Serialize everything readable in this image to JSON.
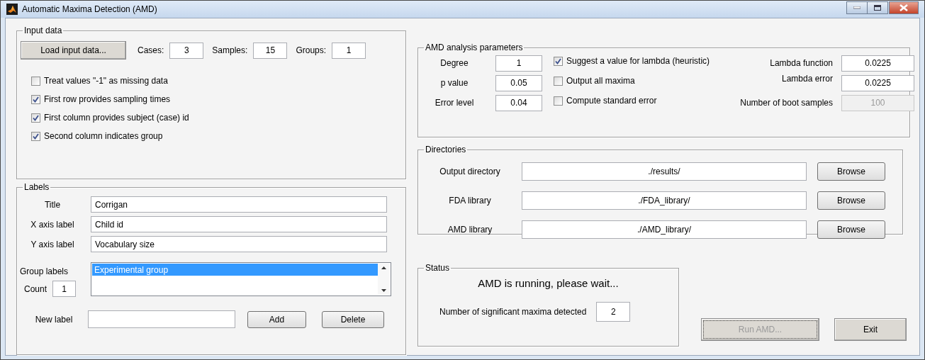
{
  "window": {
    "title": "Automatic Maxima Detection (AMD)"
  },
  "input_data": {
    "title": "Input data",
    "load_button": "Load input data...",
    "counts": [
      {
        "label": "Cases:",
        "value": "3"
      },
      {
        "label": "Samples:",
        "value": "15"
      },
      {
        "label": "Groups:",
        "value": "1"
      }
    ],
    "options": [
      {
        "label": "Treat values \"-1\" as missing data",
        "checked": false
      },
      {
        "label": "First row provides sampling times",
        "checked": true
      },
      {
        "label": "First column provides subject (case) id",
        "checked": true
      },
      {
        "label": "Second column indicates group",
        "checked": true
      }
    ]
  },
  "labels": {
    "title": "Labels",
    "fields": [
      {
        "label": "Title",
        "value": "Corrigan"
      },
      {
        "label": "X axis label",
        "value": "Child id"
      },
      {
        "label": "Y axis label",
        "value": "Vocabulary size"
      }
    ],
    "group_labels": {
      "label": "Group labels",
      "items": [
        {
          "text": "Experimental group",
          "selected": true
        }
      ]
    },
    "count": {
      "label": "Count",
      "value": "1"
    },
    "new_label": {
      "label": "New label"
    },
    "buttons": [
      "Add",
      "Delete"
    ]
  },
  "parameters": {
    "title": "AMD analysis parameters",
    "fields": [
      {
        "label": "Degree",
        "value": "1"
      },
      {
        "label": "p value",
        "value": "0.05"
      },
      {
        "label": "Error level",
        "value": "0.04"
      }
    ],
    "options": [
      {
        "label": "Suggest a value for lambda (heuristic)",
        "checked": true
      },
      {
        "label": "Output all maxima",
        "checked": false
      },
      {
        "label": "Compute standard error",
        "checked": false
      }
    ],
    "lambda_fields": [
      {
        "label": "Lambda function",
        "value": "0.0225",
        "disabled": false
      },
      {
        "label": "Lambda error",
        "value": "0.0225",
        "disabled": false
      },
      {
        "label": "Number of boot samples",
        "value": "100",
        "disabled": true
      }
    ]
  },
  "directories": {
    "title": "Directories",
    "rows": [
      {
        "label": "Output directory",
        "value": "./results/",
        "button": "Browse"
      },
      {
        "label": "FDA library",
        "value": "./FDA_library/",
        "button": "Browse"
      },
      {
        "label": "AMD library",
        "value": "./AMD_library/",
        "button": "Browse"
      }
    ]
  },
  "status": {
    "title": "Status",
    "message": "AMD is running, please wait...",
    "maxima": {
      "label": "Number of significant maxima detected",
      "value": "2"
    }
  },
  "buttons": [
    {
      "label": "Run AMD...",
      "disabled": true
    },
    {
      "label": "Exit",
      "disabled": false
    }
  ]
}
